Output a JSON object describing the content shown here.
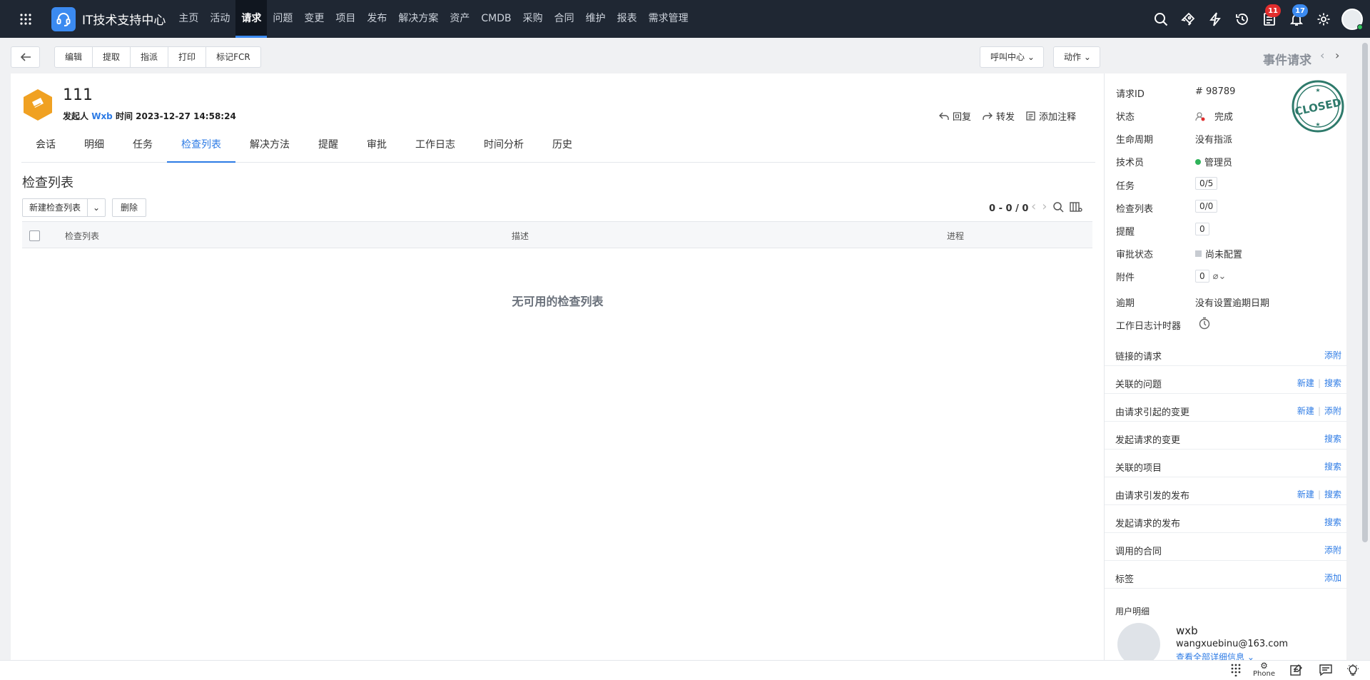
{
  "app": {
    "title": "IT技术支持中心"
  },
  "nav": [
    "主页",
    "活动",
    "请求",
    "问题",
    "变更",
    "项目",
    "发布",
    "解决方案",
    "资产",
    "CMDB",
    "采购",
    "合同",
    "维护",
    "报表",
    "需求管理"
  ],
  "badges": {
    "tasks": "11",
    "notifications": "17",
    "task_color": "#e02d2d",
    "notif_color": "#3b8af0"
  },
  "toolbar": {
    "buttons": [
      "编辑",
      "提取",
      "指派",
      "打印",
      "标记FCR"
    ],
    "call_center": "呼叫中心",
    "actions": "动作"
  },
  "panel_title": "事件请求",
  "request": {
    "title": "111",
    "by_label": "发起人",
    "requester": "Wxb",
    "time_label": "时间",
    "time": "2023-12-27 14:58:24"
  },
  "actions": {
    "reply": "回复",
    "forward": "转发",
    "add_note": "添加注释"
  },
  "tabs": [
    "会话",
    "明细",
    "任务",
    "检查列表",
    "解决方法",
    "提醒",
    "审批",
    "工作日志",
    "时间分析",
    "历史"
  ],
  "checklist": {
    "title": "检查列表",
    "new_label": "新建检查列表",
    "delete_label": "删除",
    "pager": "0 - 0 / 0",
    "columns": [
      "检查列表",
      "描述",
      "进程"
    ],
    "empty": "无可用的检查列表"
  },
  "side": {
    "props": [
      {
        "label": "请求ID",
        "value": "# 98789"
      },
      {
        "label": "状态",
        "value": "完成"
      },
      {
        "label": "生命周期",
        "value": "没有指派"
      },
      {
        "label": "技术员",
        "value": "管理员"
      },
      {
        "label": "任务",
        "value": "0/5"
      },
      {
        "label": "检查列表",
        "value": "0/0"
      },
      {
        "label": "提醒",
        "value": "0"
      },
      {
        "label": "审批状态",
        "value": "尚未配置"
      },
      {
        "label": "附件",
        "value": "0"
      },
      {
        "label": "逾期",
        "value": "没有设置逾期日期"
      },
      {
        "label": "工作日志计时器",
        "value": ""
      }
    ],
    "stamp": "CLOSED",
    "related": [
      {
        "label": "链接的请求",
        "links": [
          "添附"
        ]
      },
      {
        "label": "关联的问题",
        "links": [
          "新建",
          "搜索"
        ]
      },
      {
        "label": "由请求引起的变更",
        "links": [
          "新建",
          "添附"
        ]
      },
      {
        "label": "发起请求的变更",
        "links": [
          "搜索"
        ]
      },
      {
        "label": "关联的项目",
        "links": [
          "搜索"
        ]
      },
      {
        "label": "由请求引发的发布",
        "links": [
          "新建",
          "搜索"
        ]
      },
      {
        "label": "发起请求的发布",
        "links": [
          "搜索"
        ]
      },
      {
        "label": "调用的合同",
        "links": [
          "添附"
        ]
      },
      {
        "label": "标签",
        "links": [
          "添加"
        ]
      }
    ],
    "user": {
      "section": "用户明细",
      "name": "wxb",
      "email": "wangxuebinu@163.com",
      "more": "查看全部详细信息"
    }
  },
  "bottom": {
    "phone": "Phone"
  }
}
